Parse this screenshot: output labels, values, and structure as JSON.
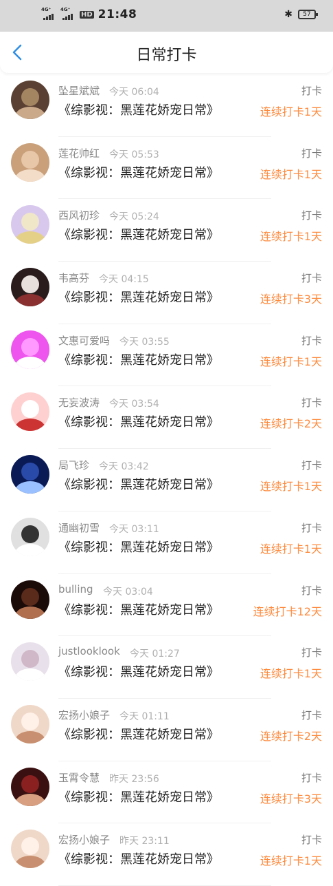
{
  "status_bar": {
    "signal1": "4G⁺",
    "signal2": "4G⁺",
    "hd": "HD",
    "time": "21:48",
    "battery": "57"
  },
  "header": {
    "title": "日常打卡",
    "back_icon": "chevron-left-icon"
  },
  "accent_color": "#ff8a3d",
  "nav_color": "#2e8ee6",
  "items": [
    {
      "name": "坠星斌斌",
      "time": "今天 06:04",
      "book": "《综影视：黑莲花娇宠日常》",
      "tag": "打卡",
      "streak": "连续打卡1天"
    },
    {
      "name": "莲花帅红",
      "time": "今天 05:53",
      "book": "《综影视：黑莲花娇宠日常》",
      "tag": "打卡",
      "streak": "连续打卡1天"
    },
    {
      "name": "西风初珍",
      "time": "今天 05:24",
      "book": "《综影视：黑莲花娇宠日常》",
      "tag": "打卡",
      "streak": "连续打卡1天"
    },
    {
      "name": "韦高芬",
      "time": "今天 04:15",
      "book": "《综影视：黑莲花娇宠日常》",
      "tag": "打卡",
      "streak": "连续打卡3天"
    },
    {
      "name": "文惠可爱吗",
      "time": "今天 03:55",
      "book": "《综影视：黑莲花娇宠日常》",
      "tag": "打卡",
      "streak": "连续打卡1天"
    },
    {
      "name": "无妄波涛",
      "time": "今天 03:54",
      "book": "《综影视：黑莲花娇宠日常》",
      "tag": "打卡",
      "streak": "连续打卡2天"
    },
    {
      "name": "局飞珍",
      "time": "今天 03:42",
      "book": "《综影视：黑莲花娇宠日常》",
      "tag": "打卡",
      "streak": "连续打卡1天"
    },
    {
      "name": "通幽初雪",
      "time": "今天 03:11",
      "book": "《综影视：黑莲花娇宠日常》",
      "tag": "打卡",
      "streak": "连续打卡1天"
    },
    {
      "name": "bulling",
      "time": "今天 03:04",
      "book": "《综影视：黑莲花娇宠日常》",
      "tag": "打卡",
      "streak": "连续打卡12天"
    },
    {
      "name": "justlooklook",
      "time": "今天 01:27",
      "book": "《综影视：黑莲花娇宠日常》",
      "tag": "打卡",
      "streak": "连续打卡1天"
    },
    {
      "name": "宏扬小娘子",
      "time": "今天 01:11",
      "book": "《综影视：黑莲花娇宠日常》",
      "tag": "打卡",
      "streak": "连续打卡2天"
    },
    {
      "name": "玉霄令慧",
      "time": "昨天 23:56",
      "book": "《综影视：黑莲花娇宠日常》",
      "tag": "打卡",
      "streak": "连续打卡3天"
    },
    {
      "name": "宏扬小娘子",
      "time": "昨天 23:11",
      "book": "《综影视：黑莲花娇宠日常》",
      "tag": "打卡",
      "streak": "连续打卡1天"
    }
  ]
}
